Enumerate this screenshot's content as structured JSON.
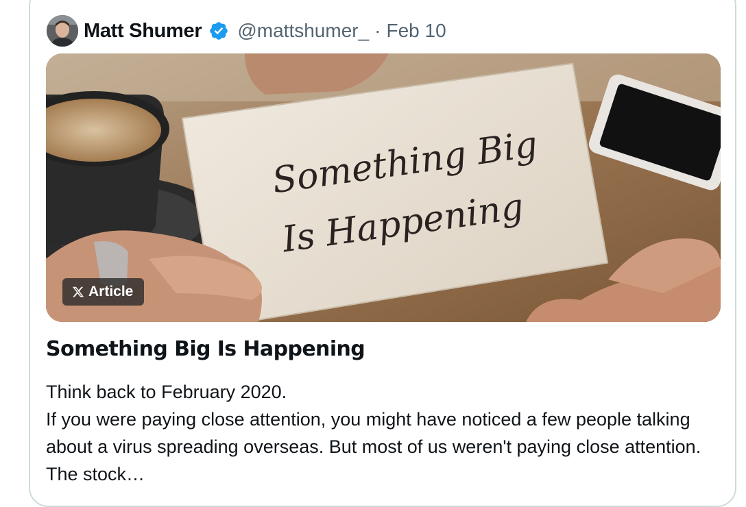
{
  "author": {
    "name": "Matt Shumer",
    "handle": "@mattshumer_",
    "separator": "·",
    "date": "Feb 10",
    "verified": true
  },
  "media": {
    "card_text_line1": "Something Big",
    "card_text_line2": "Is Happening",
    "badge_label": "Article",
    "badge_icon": "x-logo-icon"
  },
  "article": {
    "title": "Something Big Is Happening",
    "line1": "Think back to February 2020.",
    "line2": "If you were paying close attention, you might have noticed a few people talking about a virus spreading overseas. But most of us weren't paying close attention. The stock…"
  },
  "colors": {
    "verified_blue": "#1d9bf0",
    "secondary_text": "#536471",
    "border": "#cfd9de"
  }
}
